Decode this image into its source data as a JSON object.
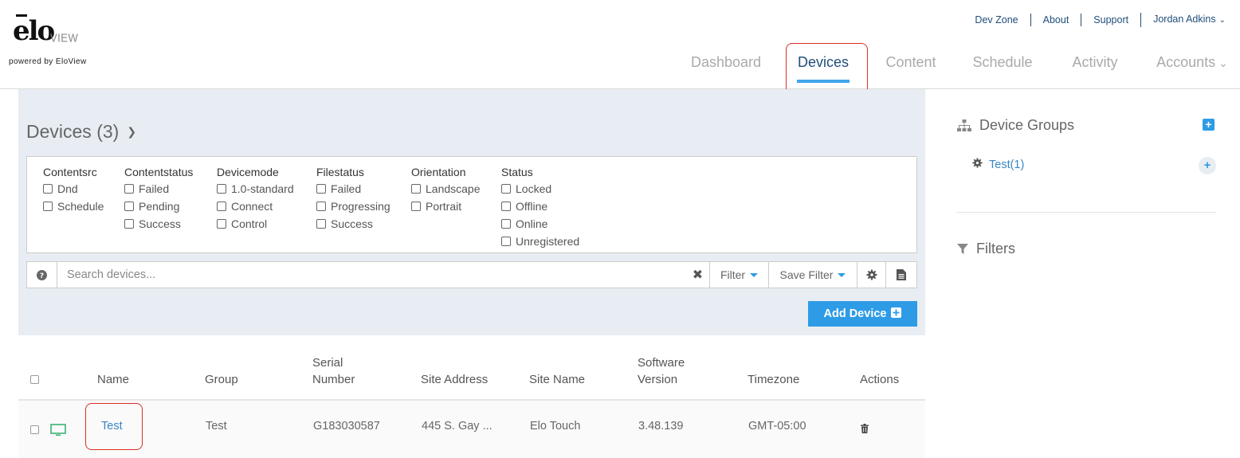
{
  "brand": {
    "logo_main": "elo",
    "logo_sub": "VIEW",
    "powered_by": "powered by EloView"
  },
  "top_links": {
    "dev_zone": "Dev Zone",
    "about": "About",
    "support": "Support",
    "user": "Jordan Adkins"
  },
  "nav": {
    "dashboard": "Dashboard",
    "devices": "Devices",
    "content": "Content",
    "schedule": "Schedule",
    "activity": "Activity",
    "accounts": "Accounts",
    "active": "Devices"
  },
  "page": {
    "title": "Devices (3)"
  },
  "filters": {
    "contentsrc": {
      "title": "Contentsrc",
      "options": [
        "Dnd",
        "Schedule"
      ]
    },
    "contentstatus": {
      "title": "Contentstatus",
      "options": [
        "Failed",
        "Pending",
        "Success"
      ]
    },
    "devicemode": {
      "title": "Devicemode",
      "options": [
        "1.0-standard",
        "Connect",
        "Control"
      ]
    },
    "filestatus": {
      "title": "Filestatus",
      "options": [
        "Failed",
        "Progressing",
        "Success"
      ]
    },
    "orientation": {
      "title": "Orientation",
      "options": [
        "Landscape",
        "Portrait"
      ]
    },
    "status": {
      "title": "Status",
      "options": [
        "Locked",
        "Offline",
        "Online",
        "Unregistered"
      ]
    }
  },
  "search": {
    "placeholder": "Search devices...",
    "value": "",
    "filter_label": "Filter",
    "save_filter_label": "Save Filter"
  },
  "actions": {
    "add_device": "Add Device"
  },
  "table": {
    "headers": {
      "name": "Name",
      "group": "Group",
      "serial_1": "Serial",
      "serial_2": "Number",
      "site_address": "Site Address",
      "site_name": "Site Name",
      "software_1": "Software",
      "software_2": "Version",
      "timezone": "Timezone",
      "actions": "Actions"
    },
    "rows": [
      {
        "name": "Test",
        "group": "Test",
        "serial": "G183030587",
        "site_address": "445 S. Gay ...",
        "site_name": "Elo Touch",
        "software": "3.48.139",
        "timezone": "GMT-05:00"
      }
    ]
  },
  "sidebar": {
    "device_groups_title": "Device Groups",
    "groups": [
      {
        "label": "Test(1)"
      }
    ],
    "filters_title": "Filters"
  },
  "colors": {
    "accent": "#2e9be6",
    "nav_active": "#1f4e79",
    "panel_bg": "#e8edf3",
    "highlight": "#d93025",
    "device_icon": "#3cb371"
  }
}
